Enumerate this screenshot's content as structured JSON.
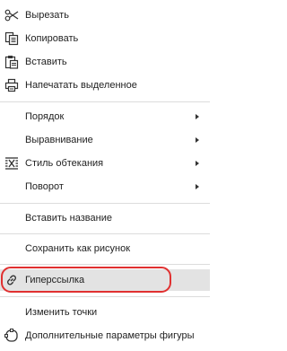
{
  "menu": {
    "items": [
      {
        "label": "Вырезать",
        "icon": "scissors-icon"
      },
      {
        "label": "Копировать",
        "icon": "copy-icon"
      },
      {
        "label": "Вставить",
        "icon": "paste-icon"
      },
      {
        "label": "Напечатать выделенное",
        "icon": "print-icon"
      },
      {
        "label": "Порядок",
        "submenu": true
      },
      {
        "label": "Выравнивание",
        "submenu": true
      },
      {
        "label": "Стиль обтекания",
        "icon": "wrap-style-icon",
        "submenu": true
      },
      {
        "label": "Поворот",
        "submenu": true
      },
      {
        "label": "Вставить название"
      },
      {
        "label": "Сохранить как рисунок"
      },
      {
        "label": "Гиперссылка",
        "icon": "hyperlink-icon",
        "highlighted": true
      },
      {
        "label": "Изменить точки"
      },
      {
        "label": "Дополнительные параметры фигуры",
        "icon": "shape-settings-icon"
      }
    ]
  },
  "colors": {
    "highlight": "#e3e3e3",
    "annotation_ring": "#e03030",
    "separator": "#dcdcdc"
  }
}
